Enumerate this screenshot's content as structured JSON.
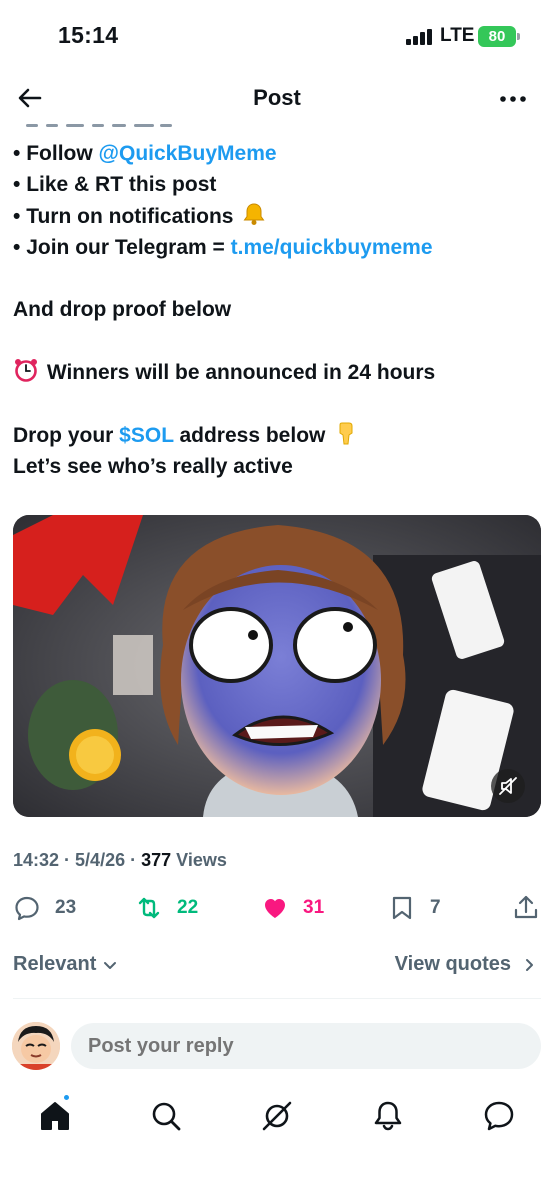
{
  "status_bar": {
    "time": "15:14",
    "network": "LTE",
    "battery": "80"
  },
  "nav": {
    "title": "Post",
    "back_icon": "arrow-left-icon",
    "more_icon": "more-horizontal-icon"
  },
  "post": {
    "lines": [
      {
        "bullet": "•",
        "text": "Follow ",
        "link": "@QuickBuyMeme"
      },
      {
        "bullet": "•",
        "text": "Like & RT this post"
      },
      {
        "bullet": "•",
        "text": "Turn on notifications ",
        "emoji": "bell-emoji"
      },
      {
        "bullet": "•",
        "text": "Join our Telegram = ",
        "link": "t.me/quickbuymeme"
      },
      {
        "text": "And drop proof below"
      },
      {
        "emoji": "alarm-clock-emoji",
        "text": " Winners will be announced in 24 hours"
      },
      {
        "text_before": "Drop your ",
        "link": "$SOL",
        "text_after": " address below ",
        "emoji": "pointing-down-emoji"
      },
      {
        "text": "Let’s see who’s really active"
      }
    ],
    "media": {
      "type": "video",
      "description_icon": "cartoon-shocked-face-video",
      "mute_icon": "muted-speaker-icon"
    },
    "meta": {
      "time": "14:32",
      "sep": " · ",
      "date": "5/4/26",
      "views_count": "377",
      "views_label": " Views"
    },
    "actions": {
      "replies": "23",
      "reposts": "22",
      "likes": "31",
      "bookmarks": "7"
    }
  },
  "replies": {
    "sort_label": "Relevant",
    "view_quotes": "View quotes"
  },
  "composer": {
    "placeholder": "Post your reply"
  },
  "bottom_nav": {
    "items": [
      "home-icon",
      "search-icon",
      "grok-icon",
      "notifications-icon",
      "messages-icon"
    ]
  },
  "colors": {
    "link": "#1d9bf0",
    "repost": "#00ba7c",
    "like": "#f91880",
    "muted": "#536471",
    "battery": "#34c759"
  }
}
